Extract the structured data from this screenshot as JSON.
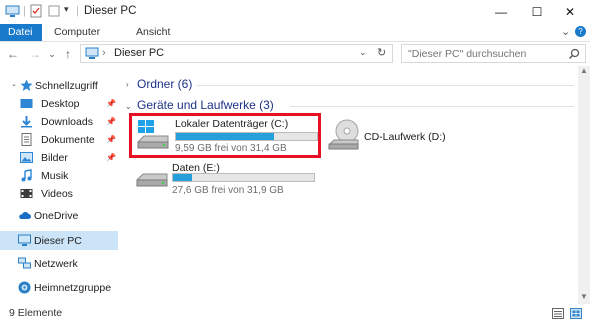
{
  "window": {
    "title": "Dieser PC",
    "minimize": "—",
    "maximize": "☐",
    "close": "✕"
  },
  "ribbon": {
    "tabs": [
      {
        "label": "Datei",
        "active": true
      },
      {
        "label": "Computer",
        "active": false
      },
      {
        "label": "Ansicht",
        "active": false
      }
    ],
    "expand": "⌄",
    "help": "?"
  },
  "navigation": {
    "back": "←",
    "forward": "→",
    "recent": "⌄",
    "up": "↑",
    "address_crumb": "Dieser PC",
    "address_sep": "›",
    "refresh": "↻",
    "search_placeholder": "\"Dieser PC\" durchsuchen"
  },
  "sidebar": {
    "items": [
      {
        "label": "Schnellzugriff",
        "icon": "star-icon"
      },
      {
        "label": "Desktop",
        "icon": "desktop-folder-icon",
        "pinned": true
      },
      {
        "label": "Downloads",
        "icon": "downloads-folder-icon",
        "pinned": true
      },
      {
        "label": "Dokumente",
        "icon": "documents-folder-icon",
        "pinned": true
      },
      {
        "label": "Bilder",
        "icon": "pictures-folder-icon",
        "pinned": true
      },
      {
        "label": "Musik",
        "icon": "music-icon"
      },
      {
        "label": "Videos",
        "icon": "videos-folder-icon"
      },
      {
        "label": "OneDrive",
        "icon": "cloud-icon"
      },
      {
        "label": "Dieser PC",
        "icon": "computer-icon",
        "selected": true
      },
      {
        "label": "Netzwerk",
        "icon": "network-icon"
      },
      {
        "label": "Heimnetzgruppe",
        "icon": "homegroup-icon"
      }
    ]
  },
  "main": {
    "folders_group": "Ordner (6)",
    "drives_group": "Geräte und Laufwerke (3)",
    "drives": [
      {
        "name": "Lokaler Datenträger (C:)",
        "free_text": "9,59 GB frei von 31,4 GB",
        "used_fraction": 0.695,
        "highlighted": true
      },
      {
        "name": "CD-Laufwerk (D:)"
      },
      {
        "name": "Daten (E:)",
        "free_text": "27,6 GB frei von 31,9 GB",
        "used_fraction": 0.135
      }
    ]
  },
  "status_bar": {
    "count": "9 Elemente"
  },
  "colors": {
    "accent": "#1979ca",
    "selection": "#cce4f7",
    "bar_fill": "#26a0da",
    "highlight_border": "#e81123",
    "group_header": "#1e3287"
  }
}
